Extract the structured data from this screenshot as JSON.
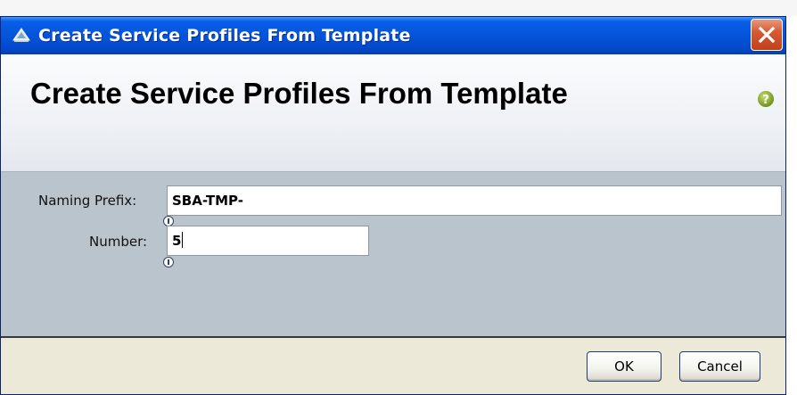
{
  "window": {
    "title": "Create Service Profiles From Template",
    "title_icon": "service-profile-template-icon",
    "close_icon": "close-icon"
  },
  "header": {
    "title": "Create Service Profiles From Template",
    "help_icon": "help-icon"
  },
  "form": {
    "naming_prefix": {
      "label": "Naming Prefix:",
      "value": "SBA-TMP-"
    },
    "number": {
      "label": "Number:",
      "value": "5"
    }
  },
  "footer": {
    "ok_label": "OK",
    "cancel_label": "Cancel"
  },
  "colors": {
    "titlebar": "#0453d8",
    "close_button": "#d65a32",
    "body_panel": "#bac4cd",
    "footer": "#ece9d8",
    "help_icon": "#8fb02a"
  }
}
